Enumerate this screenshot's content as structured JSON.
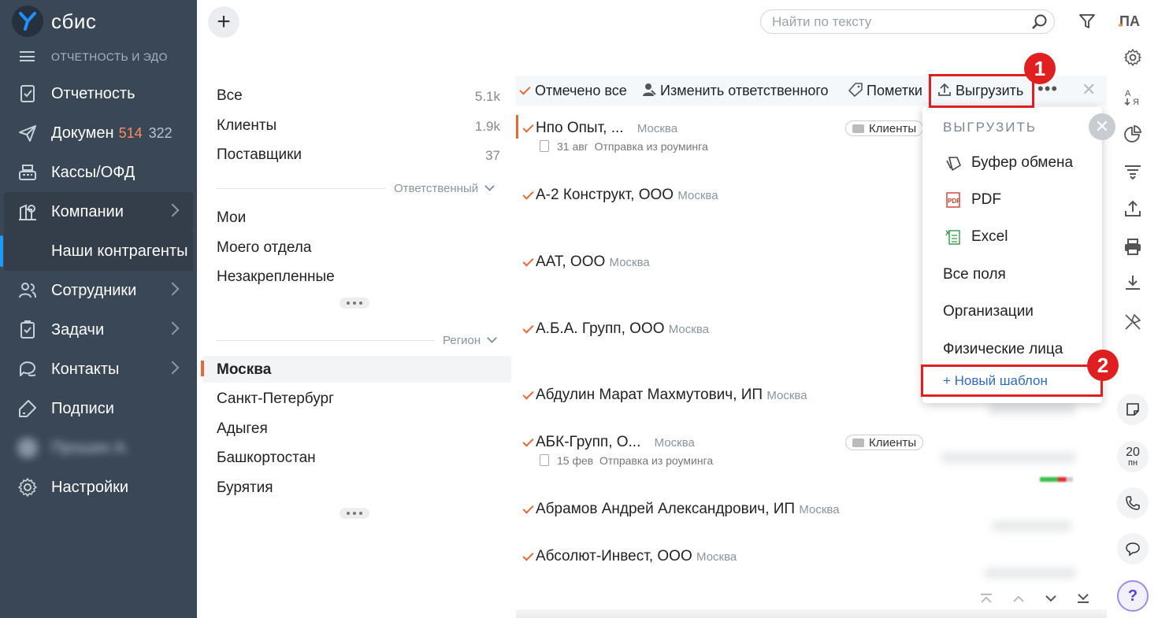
{
  "app": {
    "logo_text": "сбис",
    "section": "ОТЧЕТНОСТЬ И ЭДО",
    "user_initials": "ПА"
  },
  "sidebar": {
    "items": [
      {
        "label": "Отчетность",
        "icon": "report-icon"
      },
      {
        "label": "Докумен",
        "badge1": "514",
        "badge2": "322",
        "icon": "send-icon"
      },
      {
        "label": "Кассы/ОФД",
        "icon": "cash-register-icon"
      },
      {
        "label": "Компании",
        "icon": "company-icon"
      },
      {
        "label": "Наши контрагенты"
      },
      {
        "label": "Сотрудники",
        "icon": "employees-icon"
      },
      {
        "label": "Задачи",
        "icon": "tasks-icon"
      },
      {
        "label": "Контакты",
        "icon": "contacts-icon"
      },
      {
        "label": "Подписи",
        "icon": "signature-icon"
      },
      {
        "label": "Прошин А."
      },
      {
        "label": "Настройки",
        "icon": "settings-icon"
      }
    ]
  },
  "search": {
    "placeholder": "Найти по тексту"
  },
  "filters": {
    "groups": [
      {
        "label": "Все",
        "count": "5.1k"
      },
      {
        "label": "Клиенты",
        "count": "1.9k"
      },
      {
        "label": "Поставщики",
        "count": "37"
      }
    ],
    "responsible_header": "Ответственный",
    "responsible": [
      "Мои",
      "Моего отдела",
      "Незакрепленные"
    ],
    "region_header": "Регион",
    "regions": [
      "Москва",
      "Санкт-Петербург",
      "Адыгея",
      "Башкортостан",
      "Бурятия"
    ]
  },
  "toolbar": {
    "select_all": "Отмечено все",
    "change_responsible": "Изменить ответственного",
    "marks": "Пометки",
    "export": "Выгрузить"
  },
  "list": [
    {
      "name": "Нпо Опыт, ...",
      "city": "Москва",
      "tag": "Клиенты",
      "date": "31 авг",
      "note": "Отправка из роуминга"
    },
    {
      "name": "А-2 Конструкт, ООО",
      "city": "Москва"
    },
    {
      "name": "ААТ, ООО",
      "city": "Москва"
    },
    {
      "name": "А.Б.А. Групп, ООО",
      "city": "Москва"
    },
    {
      "name": "Абдулин Марат Махмутович, ИП",
      "city": "Москва"
    },
    {
      "name": "АБК-Групп, О...",
      "city": "Москва",
      "tag": "Клиенты",
      "date": "15 фев",
      "note": "Отправка из роуминга"
    },
    {
      "name": "Абрамов Андрей Александрович, ИП",
      "city": "Москва"
    },
    {
      "name": "Абсолют-Инвест, ООО",
      "city": "Москва"
    }
  ],
  "export_menu": {
    "header": "ВЫГРУЗИТЬ",
    "items": [
      "Буфер обмена",
      "PDF",
      "Excel",
      "Все поля",
      "Организации",
      "Физические лица"
    ],
    "new_template": "+ Новый шаблон"
  },
  "callouts": {
    "one": "1",
    "two": "2"
  },
  "right_panel": {
    "calendar_day": "20",
    "calendar_weekday": "пн",
    "help": "?"
  },
  "colors": {
    "sidebar": "#3a4756",
    "accent": "#e8683a",
    "callout": "#e02020",
    "link": "#2e6bc4"
  }
}
